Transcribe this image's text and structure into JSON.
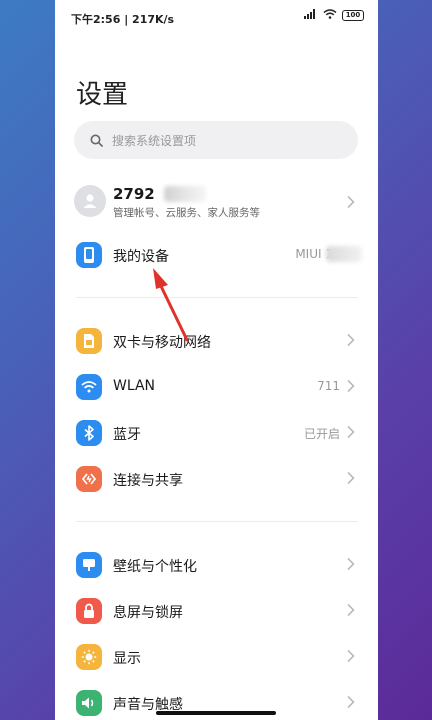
{
  "status_bar": {
    "left_text": "下午2:56 | 217K/s",
    "signal_icon": "signal-icon",
    "wifi_icon": "wifi-icon",
    "battery_level": "100"
  },
  "page": {
    "title": "设置"
  },
  "search": {
    "placeholder": "搜索系统设置项"
  },
  "account": {
    "name_visible": "2792",
    "subtitle": "管理帐号、云服务、家人服务等"
  },
  "device": {
    "label": "我的设备",
    "value": "MIUI 1"
  },
  "section1": [
    {
      "label": "双卡与移动网络",
      "value": "",
      "icon": "sim-card-icon",
      "color": "#f5b43c"
    },
    {
      "label": "WLAN",
      "value": "711",
      "icon": "wifi-icon",
      "color": "#2d8cf0"
    },
    {
      "label": "蓝牙",
      "value": "已开启",
      "icon": "bluetooth-icon",
      "color": "#2d8cf0"
    },
    {
      "label": "连接与共享",
      "value": "",
      "icon": "share-icon",
      "color": "#f0704a"
    }
  ],
  "section2": [
    {
      "label": "壁纸与个性化",
      "value": "",
      "icon": "wallpaper-icon",
      "color": "#2d8cf0"
    },
    {
      "label": "息屏与锁屏",
      "value": "",
      "icon": "lock-icon",
      "color": "#f05a4a"
    },
    {
      "label": "显示",
      "value": "",
      "icon": "brightness-icon",
      "color": "#f5b43c"
    },
    {
      "label": "声音与触感",
      "value": "",
      "icon": "sound-icon",
      "color": "#3cb371"
    }
  ],
  "colors": {
    "accent_blue": "#2d8cf0",
    "annotation_arrow": "#e0312b"
  }
}
